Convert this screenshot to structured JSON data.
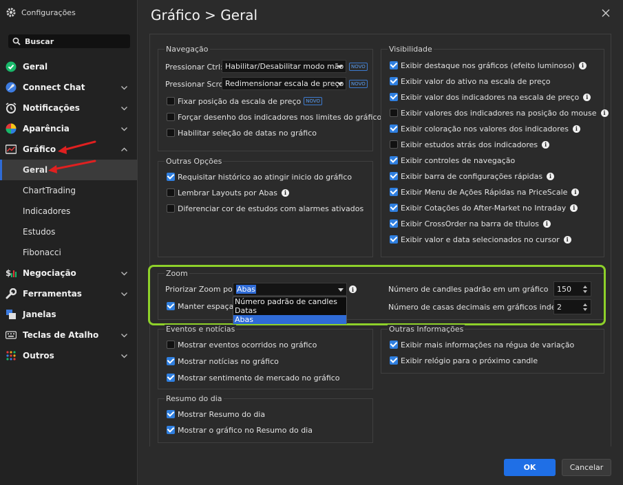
{
  "app_title": "Configurações",
  "search": {
    "label": "Buscar"
  },
  "nav": [
    {
      "label": "Geral",
      "icon": "check-circle-icon",
      "chevron": false
    },
    {
      "label": "Connect Chat",
      "icon": "rocket-icon",
      "chevron": "down"
    },
    {
      "label": "Notificações",
      "icon": "alarm-icon",
      "chevron": "down"
    },
    {
      "label": "Aparência",
      "icon": "palette-icon",
      "chevron": "down"
    },
    {
      "label": "Gráfico",
      "icon": "chart-icon",
      "chevron": "up"
    }
  ],
  "subnav": [
    {
      "label": "Geral",
      "active": true
    },
    {
      "label": "ChartTrading"
    },
    {
      "label": "Indicadores"
    },
    {
      "label": "Estudos"
    },
    {
      "label": "Fibonacci"
    }
  ],
  "nav2": [
    {
      "label": "Negociação",
      "icon": "dollar-chart-icon",
      "chevron": "down"
    },
    {
      "label": "Ferramentas",
      "icon": "wrench-icon",
      "chevron": "down"
    },
    {
      "label": "Janelas",
      "icon": "windows-icon",
      "chevron": false
    },
    {
      "label": "Teclas de Atalho",
      "icon": "keyboard-icon",
      "chevron": "down"
    },
    {
      "label": "Outros",
      "icon": "dots-grid-icon",
      "chevron": "down"
    }
  ],
  "page": {
    "title": "Gráfico > Geral"
  },
  "navegacao": {
    "title": "Navegação",
    "ctrl_label": "Pressionar Ctrl:",
    "ctrl_value": "Habilitar/Desabilitar modo mão",
    "scroll_label": "Pressionar Scroll:",
    "scroll_value": "Redimensionar escala de preço",
    "new_badge": "NOVO",
    "items": [
      {
        "label": "Fixar posição da escala de preço",
        "checked": false,
        "badge": true
      },
      {
        "label": "Forçar desenho dos indicadores nos limites do gráfico",
        "checked": false
      },
      {
        "label": "Habilitar seleção de datas no gráfico",
        "checked": false
      }
    ]
  },
  "outras_opcoes": {
    "title": "Outras Opções",
    "items": [
      {
        "label": "Requisitar histórico ao atingir inicio do gráfico",
        "checked": true
      },
      {
        "label": "Lembrar Layouts por Abas",
        "checked": false,
        "info": true
      },
      {
        "label": "Diferenciar cor de estudos com alarmes ativados",
        "checked": false
      }
    ]
  },
  "visibilidade": {
    "title": "Visibilidade",
    "items": [
      {
        "label": "Exibir destaque nos gráficos (efeito luminoso)",
        "checked": true
      },
      {
        "label": "Exibir valor do ativo na escala de preço",
        "checked": true
      },
      {
        "label": "Exibir valor dos indicadores na escala de preço",
        "checked": true
      },
      {
        "label": "Exibir valores dos indicadores na posição do mouse",
        "checked": false
      },
      {
        "label": "Exibir coloração nos valores dos indicadores",
        "checked": true
      },
      {
        "label": "Exibir estudos atrás dos indicadores",
        "checked": false
      },
      {
        "label": "Exibir controles de navegação",
        "checked": true
      },
      {
        "label": "Exibir barra de configurações rápidas",
        "checked": true
      },
      {
        "label": "Exibir Menu de Ações Rápidas na PriceScale",
        "checked": true
      },
      {
        "label": "Exibir Cotações do After-Market no Intraday",
        "checked": true
      },
      {
        "label": "Exibir CrossOrder na barra de títulos",
        "checked": true
      },
      {
        "label": "Exibir valor e data selecionados no cursor",
        "checked": true
      }
    ]
  },
  "zoom": {
    "title": "Zoom",
    "priorizar_label": "Priorizar Zoom por:",
    "priorizar_value": "Abas",
    "options": [
      "Número padrão de candles",
      "Datas",
      "Abas"
    ],
    "manter_label": "Manter espaçam",
    "manter_checked": true,
    "candles_label": "Número de candles padrão em um gráfico",
    "candles_value": "150",
    "casas_label": "Número de casas decimais em gráficos indexados",
    "casas_value": "2"
  },
  "eventos": {
    "title": "Eventos e notícias",
    "items": [
      {
        "label": "Mostrar eventos ocorridos no gráfico",
        "checked": false
      },
      {
        "label": "Mostrar notícias no gráfico",
        "checked": true
      },
      {
        "label": "Mostrar sentimento de mercado no gráfico",
        "checked": true
      }
    ]
  },
  "outras_info": {
    "title": "Outras Informações",
    "items": [
      {
        "label": "Exibir mais informações na régua de variação",
        "checked": true
      },
      {
        "label": "Exibir relógio para o próximo candle",
        "checked": true
      }
    ]
  },
  "resumo": {
    "title": "Resumo do dia",
    "items": [
      {
        "label": "Mostrar Resumo do dia",
        "checked": true
      },
      {
        "label": "Mostrar o gráfico no Resumo do dia",
        "checked": true
      }
    ]
  },
  "buttons": {
    "ok": "OK",
    "cancel": "Cancelar"
  },
  "colors": {
    "accent": "#2f7fe0",
    "highlight": "#8ed12a",
    "arrow": "#e02020"
  }
}
